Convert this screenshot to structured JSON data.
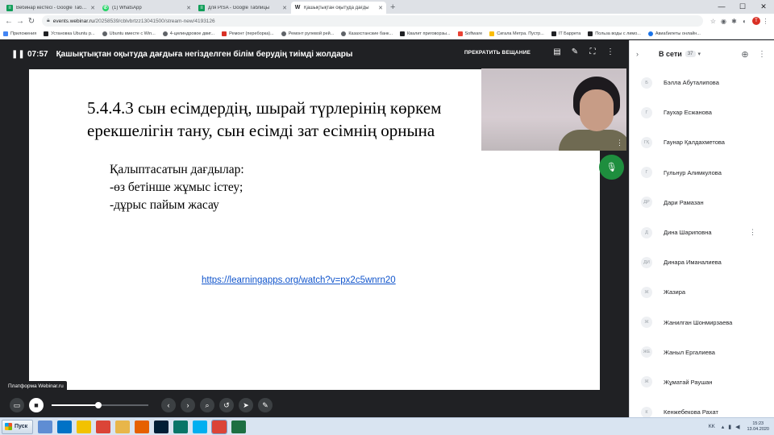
{
  "browser": {
    "tabs": [
      {
        "title": "Вебинар кестесі - Google Таблицы",
        "icon": "sheets-icon",
        "color": "#0f9d58"
      },
      {
        "title": "(1) WhatsApp",
        "icon": "whatsapp-icon",
        "color": "#25d366"
      },
      {
        "title": "для PISA - Google Таблицы",
        "icon": "sheets-icon",
        "color": "#0f9d58"
      },
      {
        "title": "Қашықтықтан оқытуда дағды",
        "icon": "webinar-icon",
        "color": "#202124",
        "active": true
      }
    ],
    "new_tab": "+",
    "window_controls": {
      "minimize": "—",
      "maximize": "☐",
      "close": "✕"
    },
    "url_host": "events.webinar.ru",
    "url_path": "/20258539/cblvbrtzz13041500/stream-new/4193126",
    "bookmarks": [
      {
        "label": "Приложения",
        "color": "#4285f4"
      },
      {
        "label": "Установка Ubuntu р...",
        "color": "#202124"
      },
      {
        "label": "Ubuntu вместе с Win...",
        "color": "#5f6368"
      },
      {
        "label": "4-цилиндровое двиг...",
        "color": "#5f6368"
      },
      {
        "label": "Ремонт (переборка)...",
        "color": "#d93025"
      },
      {
        "label": "Ремонт рулевой рей...",
        "color": "#5f6368"
      },
      {
        "label": "Казахстанские банк...",
        "color": "#5f6368"
      },
      {
        "label": "Квалит приговорзы...",
        "color": "#202124"
      },
      {
        "label": "Software",
        "color": "#ea4335"
      },
      {
        "label": "Сигала Метра. Пустр...",
        "color": "#fbbc04"
      },
      {
        "label": "IT Баррета",
        "color": "#202124"
      },
      {
        "label": "Польза воды с лимо...",
        "color": "#202124"
      },
      {
        "label": "Авиабилеты онлайн...",
        "color": "#1a73e8"
      }
    ]
  },
  "webinar": {
    "timer": "07:57",
    "title": "Қашықтықтан оқытуда дағдыға негізделген білім берудің тиімді жолдары",
    "stop_label": "ПРЕКРАТИТЬ ВЕЩАНИЕ",
    "slide": {
      "heading_line1": "5.4.4.3 сын есімдердің, шырай  түрлерінің көркем",
      "heading_line2": "ерекшелігін тану, сын есімді зат есімнің орнына",
      "list_title": "Қалыптасатын дағдылар:",
      "list_item1": "-өз бетінше жұмыс істеу;",
      "list_item2": "-дұрыс пайым жасау",
      "link": "https://learningapps.org/watch?v=px2c5wnrn20"
    },
    "platform_label": "Платформа Webinar.ru",
    "volume_level": 0.48
  },
  "sidebar": {
    "header_label": "В сети",
    "count": "37",
    "participants": [
      {
        "initials": "Б",
        "name": "Бэлла Абуталипова"
      },
      {
        "initials": "Г",
        "name": "Гаухар Есжанова"
      },
      {
        "initials": "ГҚ",
        "name": "Гаунар Қалдахметова"
      },
      {
        "initials": "Г",
        "name": "Гульнур Алимкулова"
      },
      {
        "initials": "ДР",
        "name": "Дари Рамазан"
      },
      {
        "initials": "Д",
        "name": "Дина Шариповна"
      },
      {
        "initials": "ДИ",
        "name": "Динара Иманалиева"
      },
      {
        "initials": "Ж",
        "name": "Жазира"
      },
      {
        "initials": "Ж",
        "name": "Жанилган Шонмирзаева"
      },
      {
        "initials": "ЖЕ",
        "name": "Жаныл Ергалиева"
      },
      {
        "initials": "Ж",
        "name": "Жұматай Раушан"
      },
      {
        "initials": "К",
        "name": "Кенжебекова Рахат"
      }
    ]
  },
  "taskbar": {
    "start_label": "Пуск",
    "apps": [
      {
        "icon": "paint-icon",
        "color": "#5f8dd3"
      },
      {
        "icon": "outlook-icon",
        "color": "#0072c6"
      },
      {
        "icon": "lightbulb-icon",
        "color": "#f2c200"
      },
      {
        "icon": "chrome-icon",
        "color": "#db4437"
      },
      {
        "icon": "folder-icon",
        "color": "#e8b64a"
      },
      {
        "icon": "firefox-icon",
        "color": "#e66000"
      },
      {
        "icon": "photoshop-icon",
        "color": "#001e36"
      },
      {
        "icon": "publisher-icon",
        "color": "#077568"
      },
      {
        "icon": "skype-icon",
        "color": "#00aff0"
      },
      {
        "icon": "chrome-icon",
        "color": "#db4437",
        "active": true
      },
      {
        "icon": "excel-icon",
        "color": "#1d6f42"
      }
    ],
    "lang": "KK",
    "time": "15:23",
    "date": "13.04.2020"
  }
}
